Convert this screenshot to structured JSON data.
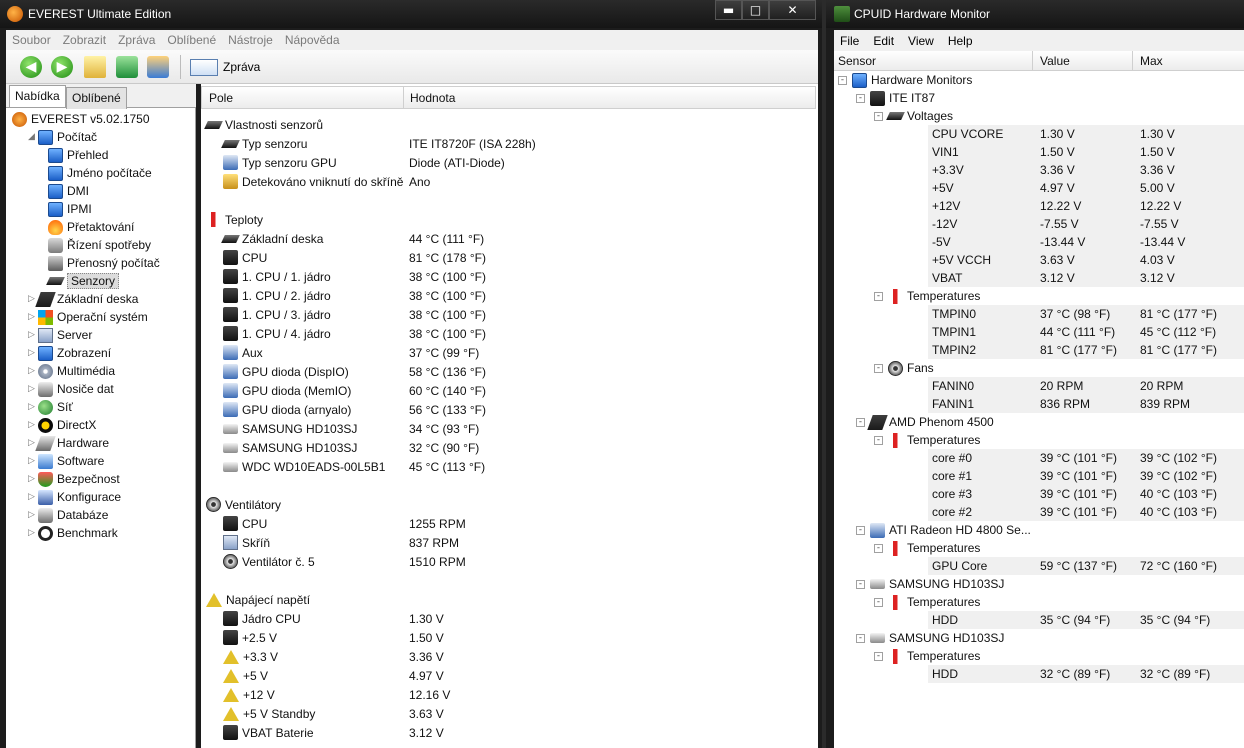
{
  "everest": {
    "title": "EVEREST Ultimate Edition",
    "window_controls": {
      "minimize": "▬",
      "maximize": "□",
      "close": "✕"
    },
    "menu": [
      "Soubor",
      "Zobrazit",
      "Zpráva",
      "Oblíbené",
      "Nástroje",
      "Nápověda"
    ],
    "toolbar": {
      "report_label": "Zpráva"
    },
    "tabs": [
      "Nabídka",
      "Oblíbené"
    ],
    "tree": [
      {
        "label": "EVEREST v5.02.1750",
        "icon": "everest-icon"
      },
      {
        "label": "Počítač",
        "icon": "computer-icon"
      },
      {
        "label": "Přehled",
        "icon": "monitor-icon"
      },
      {
        "label": "Jméno počítače",
        "icon": "monitor-icon"
      },
      {
        "label": "DMI",
        "icon": "monitor-icon"
      },
      {
        "label": "IPMI",
        "icon": "monitor-icon"
      },
      {
        "label": "Přetaktování",
        "icon": "fire-icon"
      },
      {
        "label": "Řízení spotřeby",
        "icon": "plug-icon"
      },
      {
        "label": "Přenosný počítač",
        "icon": "laptop-icon"
      },
      {
        "label": "Senzory",
        "icon": "sensor-icon",
        "selected": true
      },
      {
        "label": "Základní deska",
        "icon": "motherboard-icon"
      },
      {
        "label": "Operační systém",
        "icon": "windows-icon"
      },
      {
        "label": "Server",
        "icon": "server-icon"
      },
      {
        "label": "Zobrazení",
        "icon": "display-icon"
      },
      {
        "label": "Multimédia",
        "icon": "multimedia-icon"
      },
      {
        "label": "Nosiče dat",
        "icon": "storage-icon"
      },
      {
        "label": "Síť",
        "icon": "network-icon"
      },
      {
        "label": "DirectX",
        "icon": "directx-icon"
      },
      {
        "label": "Hardware",
        "icon": "hardware-icon"
      },
      {
        "label": "Software",
        "icon": "software-icon"
      },
      {
        "label": "Bezpečnost",
        "icon": "security-icon"
      },
      {
        "label": "Konfigurace",
        "icon": "config-icon"
      },
      {
        "label": "Databáze",
        "icon": "database-icon"
      },
      {
        "label": "Benchmark",
        "icon": "benchmark-icon"
      }
    ],
    "grid_headers": {
      "field": "Pole",
      "value": "Hodnota"
    },
    "sections": [
      {
        "title": "Vlastnosti senzorů",
        "rows": [
          {
            "label": "Typ senzoru",
            "value": "ITE IT8720F  (ISA 228h)"
          },
          {
            "label": "Typ senzoru GPU",
            "value": "Diode  (ATI-Diode)"
          },
          {
            "label": "Detekováno vniknutí do skříně",
            "value": "Ano"
          }
        ]
      },
      {
        "title": "Teploty",
        "rows": [
          {
            "label": "Základní deska",
            "value": "44 °C  (111 °F)"
          },
          {
            "label": "CPU",
            "value": "81 °C  (178 °F)"
          },
          {
            "label": "1. CPU / 1. jádro",
            "value": "38 °C  (100 °F)"
          },
          {
            "label": "1. CPU / 2. jádro",
            "value": "38 °C  (100 °F)"
          },
          {
            "label": "1. CPU / 3. jádro",
            "value": "38 °C  (100 °F)"
          },
          {
            "label": "1. CPU / 4. jádro",
            "value": "38 °C  (100 °F)"
          },
          {
            "label": "Aux",
            "value": "37 °C  (99 °F)"
          },
          {
            "label": "GPU dioda (DispIO)",
            "value": "58 °C  (136 °F)"
          },
          {
            "label": "GPU dioda (MemIO)",
            "value": "60 °C  (140 °F)"
          },
          {
            "label": "GPU dioda (arnyalo)",
            "value": "56 °C  (133 °F)"
          },
          {
            "label": "SAMSUNG HD103SJ",
            "value": "34 °C  (93 °F)"
          },
          {
            "label": "SAMSUNG HD103SJ",
            "value": "32 °C  (90 °F)"
          },
          {
            "label": "WDC WD10EADS-00L5B1",
            "value": "45 °C  (113 °F)"
          }
        ]
      },
      {
        "title": "Ventilátory",
        "rows": [
          {
            "label": "CPU",
            "value": "1255 RPM"
          },
          {
            "label": "Skříň",
            "value": "837 RPM"
          },
          {
            "label": "Ventilátor č. 5",
            "value": "1510 RPM"
          }
        ]
      },
      {
        "title": "Napájecí napětí",
        "rows": [
          {
            "label": "Jádro CPU",
            "value": "1.30 V"
          },
          {
            "label": "+2.5 V",
            "value": "1.50 V"
          },
          {
            "label": "+3.3 V",
            "value": "3.36 V"
          },
          {
            "label": "+5 V",
            "value": "4.97 V"
          },
          {
            "label": "+12 V",
            "value": "12.16 V"
          },
          {
            "label": "+5 V Standby",
            "value": "3.63 V"
          },
          {
            "label": "VBAT Baterie",
            "value": "3.12 V"
          }
        ]
      }
    ]
  },
  "hwmonitor": {
    "title": "CPUID Hardware Monitor",
    "menu": [
      "File",
      "Edit",
      "View",
      "Help"
    ],
    "columns": [
      "Sensor",
      "Value",
      "Max"
    ],
    "root": "Hardware Monitors",
    "devices": [
      {
        "name": "ITE IT87",
        "groups": [
          {
            "name": "Voltages",
            "rows": [
              [
                "CPU VCORE",
                "1.30 V",
                "1.30 V"
              ],
              [
                "VIN1",
                "1.50 V",
                "1.50 V"
              ],
              [
                "+3.3V",
                "3.36 V",
                "3.36 V"
              ],
              [
                "+5V",
                "4.97 V",
                "5.00 V"
              ],
              [
                "+12V",
                "12.22 V",
                "12.22 V"
              ],
              [
                "-12V",
                "-7.55 V",
                "-7.55 V"
              ],
              [
                "-5V",
                "-13.44 V",
                "-13.44 V"
              ],
              [
                "+5V VCCH",
                "3.63 V",
                "4.03 V"
              ],
              [
                "VBAT",
                "3.12 V",
                "3.12 V"
              ]
            ]
          },
          {
            "name": "Temperatures",
            "rows": [
              [
                "TMPIN0",
                "37 °C  (98 °F)",
                "81 °C  (177 °F)"
              ],
              [
                "TMPIN1",
                "44 °C  (111 °F)",
                "45 °C  (112 °F)"
              ],
              [
                "TMPIN2",
                "81 °C  (177 °F)",
                "81 °C  (177 °F)"
              ]
            ]
          },
          {
            "name": "Fans",
            "rows": [
              [
                "FANIN0",
                "20 RPM",
                "20 RPM"
              ],
              [
                "FANIN1",
                "836 RPM",
                "839 RPM"
              ]
            ]
          }
        ]
      },
      {
        "name": "AMD Phenom 4500",
        "groups": [
          {
            "name": "Temperatures",
            "rows": [
              [
                "core #0",
                "39 °C  (101 °F)",
                "39 °C  (102 °F)"
              ],
              [
                "core #1",
                "39 °C  (101 °F)",
                "39 °C  (102 °F)"
              ],
              [
                "core #3",
                "39 °C  (101 °F)",
                "40 °C  (103 °F)"
              ],
              [
                "core #2",
                "39 °C  (101 °F)",
                "40 °C  (103 °F)"
              ]
            ]
          }
        ]
      },
      {
        "name": "ATI Radeon HD 4800 Se...",
        "groups": [
          {
            "name": "Temperatures",
            "rows": [
              [
                "GPU Core",
                "59 °C  (137 °F)",
                "72 °C  (160 °F)"
              ]
            ]
          }
        ]
      },
      {
        "name": "SAMSUNG HD103SJ",
        "groups": [
          {
            "name": "Temperatures",
            "rows": [
              [
                "HDD",
                "35 °C  (94 °F)",
                "35 °C  (94 °F)"
              ]
            ]
          }
        ]
      },
      {
        "name": "SAMSUNG HD103SJ",
        "groups": [
          {
            "name": "Temperatures",
            "rows": [
              [
                "HDD",
                "32 °C  (89 °F)",
                "32 °C  (89 °F)"
              ]
            ]
          }
        ]
      }
    ]
  }
}
